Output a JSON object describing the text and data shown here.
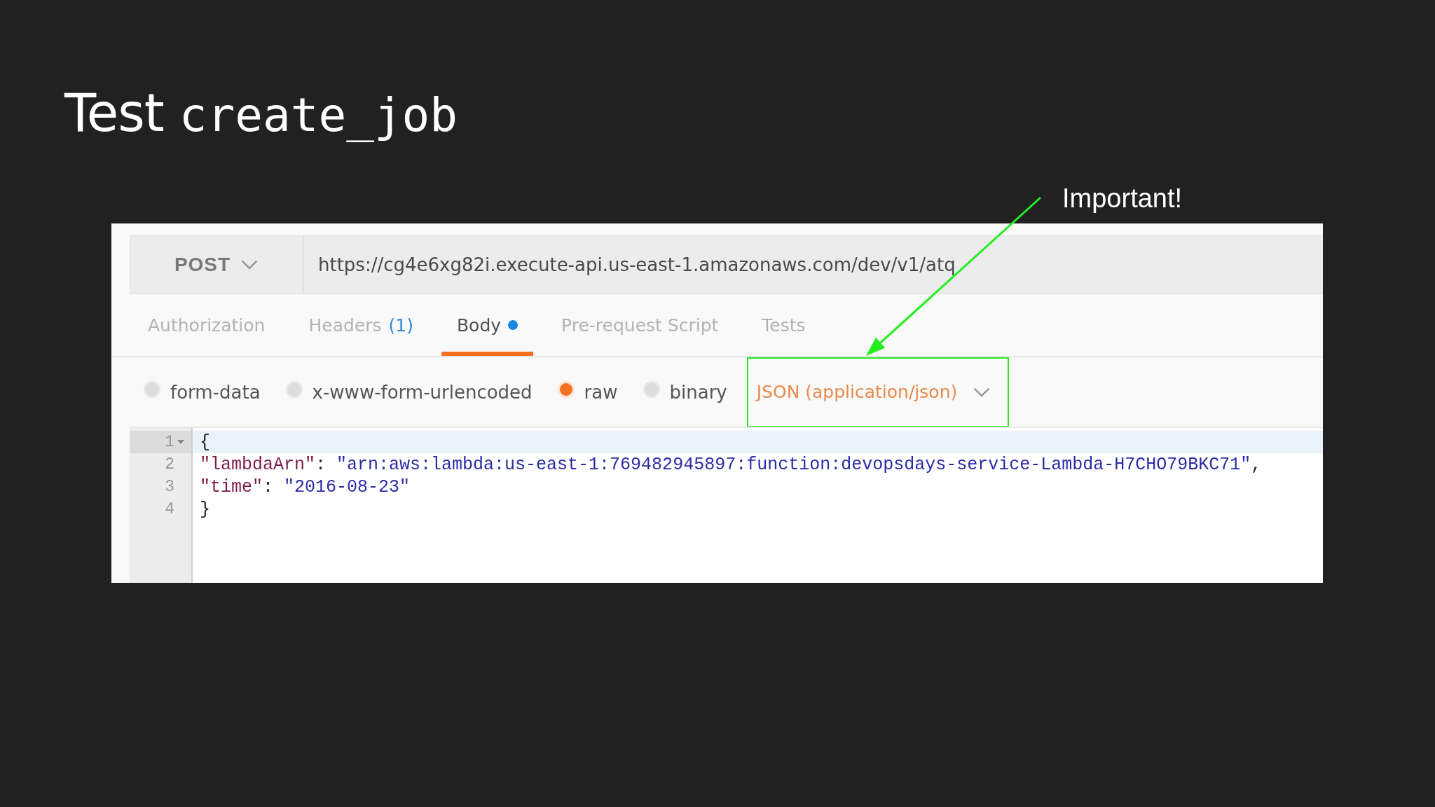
{
  "slide": {
    "title": "Test",
    "title_code": "create_job",
    "annotation": "Important!"
  },
  "request": {
    "method": "POST",
    "url": "https://cg4e6xg82i.execute-api.us-east-1.amazonaws.com/dev/v1/atq"
  },
  "tabs": [
    {
      "label": "Authorization",
      "selected": false,
      "modified": false
    },
    {
      "label": "Headers",
      "count": "(1)",
      "selected": false,
      "modified": false
    },
    {
      "label": "Body",
      "selected": true,
      "modified": true
    },
    {
      "label": "Pre-request Script",
      "selected": false,
      "modified": false
    },
    {
      "label": "Tests",
      "selected": false,
      "modified": false
    }
  ],
  "body_modes": [
    {
      "label": "form-data",
      "selected": false
    },
    {
      "label": "x-www-form-urlencoded",
      "selected": false
    },
    {
      "label": "raw",
      "selected": true
    },
    {
      "label": "binary",
      "selected": false
    }
  ],
  "content_type": {
    "label": "JSON (application/json)",
    "highlighted": true
  },
  "editor": {
    "lines": [
      {
        "number": "1",
        "foldable": true,
        "active": true,
        "tokens": [
          {
            "kind": "punct",
            "text": "{"
          }
        ]
      },
      {
        "number": "2",
        "foldable": false,
        "active": false,
        "tokens": [
          {
            "kind": "key",
            "text": "\"lambdaArn\""
          },
          {
            "kind": "punct",
            "text": ": "
          },
          {
            "kind": "string",
            "text": "\"arn:aws:lambda:us-east-1:769482945897:function:devopsdays-service-Lambda-H7CHO79BKC71\""
          },
          {
            "kind": "punct",
            "text": ","
          }
        ]
      },
      {
        "number": "3",
        "foldable": false,
        "active": false,
        "tokens": [
          {
            "kind": "key",
            "text": "\"time\""
          },
          {
            "kind": "punct",
            "text": ": "
          },
          {
            "kind": "string",
            "text": "\"2016-08-23\""
          }
        ]
      },
      {
        "number": "4",
        "foldable": false,
        "active": false,
        "tokens": [
          {
            "kind": "punct",
            "text": "}"
          }
        ]
      }
    ]
  }
}
